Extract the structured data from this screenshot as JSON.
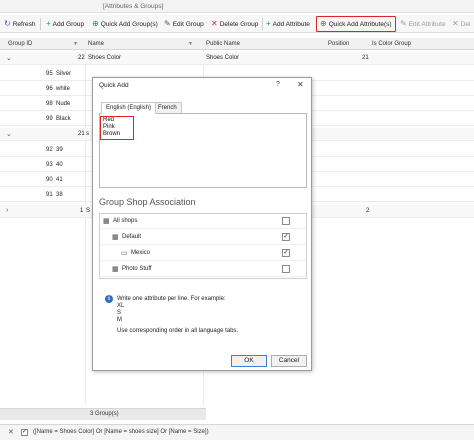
{
  "window": {
    "breadcrumb": "[Attributes & Groups]"
  },
  "toolbar": {
    "refresh": "Refresh",
    "add_group": "Add Group",
    "quick_add_groups": "Quick Add Group(s)",
    "edit_group": "Edit Group",
    "delete_group": "Delete Group",
    "add_attribute": "Add Attribute",
    "quick_add_attributes": "Quick Add Attribute(s)",
    "edit_attribute": "Edit Attribute",
    "delete_attribute": "Del"
  },
  "grid": {
    "columns": {
      "group_id": "Group ID",
      "name": "Name",
      "public_name": "Public Name",
      "position": "Position",
      "is_color_group": "Is Color Group"
    },
    "group1": {
      "id": "22",
      "name": "Shoes Color",
      "public_name": "Shoes Color",
      "position": "21"
    },
    "group1_items": [
      {
        "id": "95",
        "name": "Silver"
      },
      {
        "id": "96",
        "name": "white"
      },
      {
        "id": "98",
        "name": "Nude"
      },
      {
        "id": "99",
        "name": "Black"
      }
    ],
    "group2": {
      "id": "21",
      "name": "s"
    },
    "group2_items": [
      {
        "id": "92",
        "name": "39"
      },
      {
        "id": "93",
        "name": "40"
      },
      {
        "id": "90",
        "name": "41"
      },
      {
        "id": "91",
        "name": "38"
      }
    ],
    "group3": {
      "id": "1",
      "name": "S",
      "position": "2"
    },
    "footer_count": "3 Group(s)"
  },
  "filter": {
    "expression": "([Name = Shoes Color] Or [Name = shoes size] Or [Name = Size])"
  },
  "dialog": {
    "title": "Quick Add",
    "help": "?",
    "tabs": [
      "English (English)",
      "French"
    ],
    "text_lines": [
      "Red",
      "Pink",
      "Brown"
    ],
    "section_title": "Group Shop Association",
    "shops": [
      {
        "label": "All shops",
        "checked": false
      },
      {
        "label": "Default",
        "checked": true
      },
      {
        "label": "Mexico",
        "checked": true
      },
      {
        "label": "Photo Stuff",
        "checked": false
      }
    ],
    "info": {
      "line1": "Write one attribute per line. For example:",
      "examples": [
        "XL",
        "S",
        "M"
      ],
      "line2": "Use corresponding order in all language tabs."
    },
    "ok_label": "OK",
    "cancel_label": "Cancel"
  }
}
